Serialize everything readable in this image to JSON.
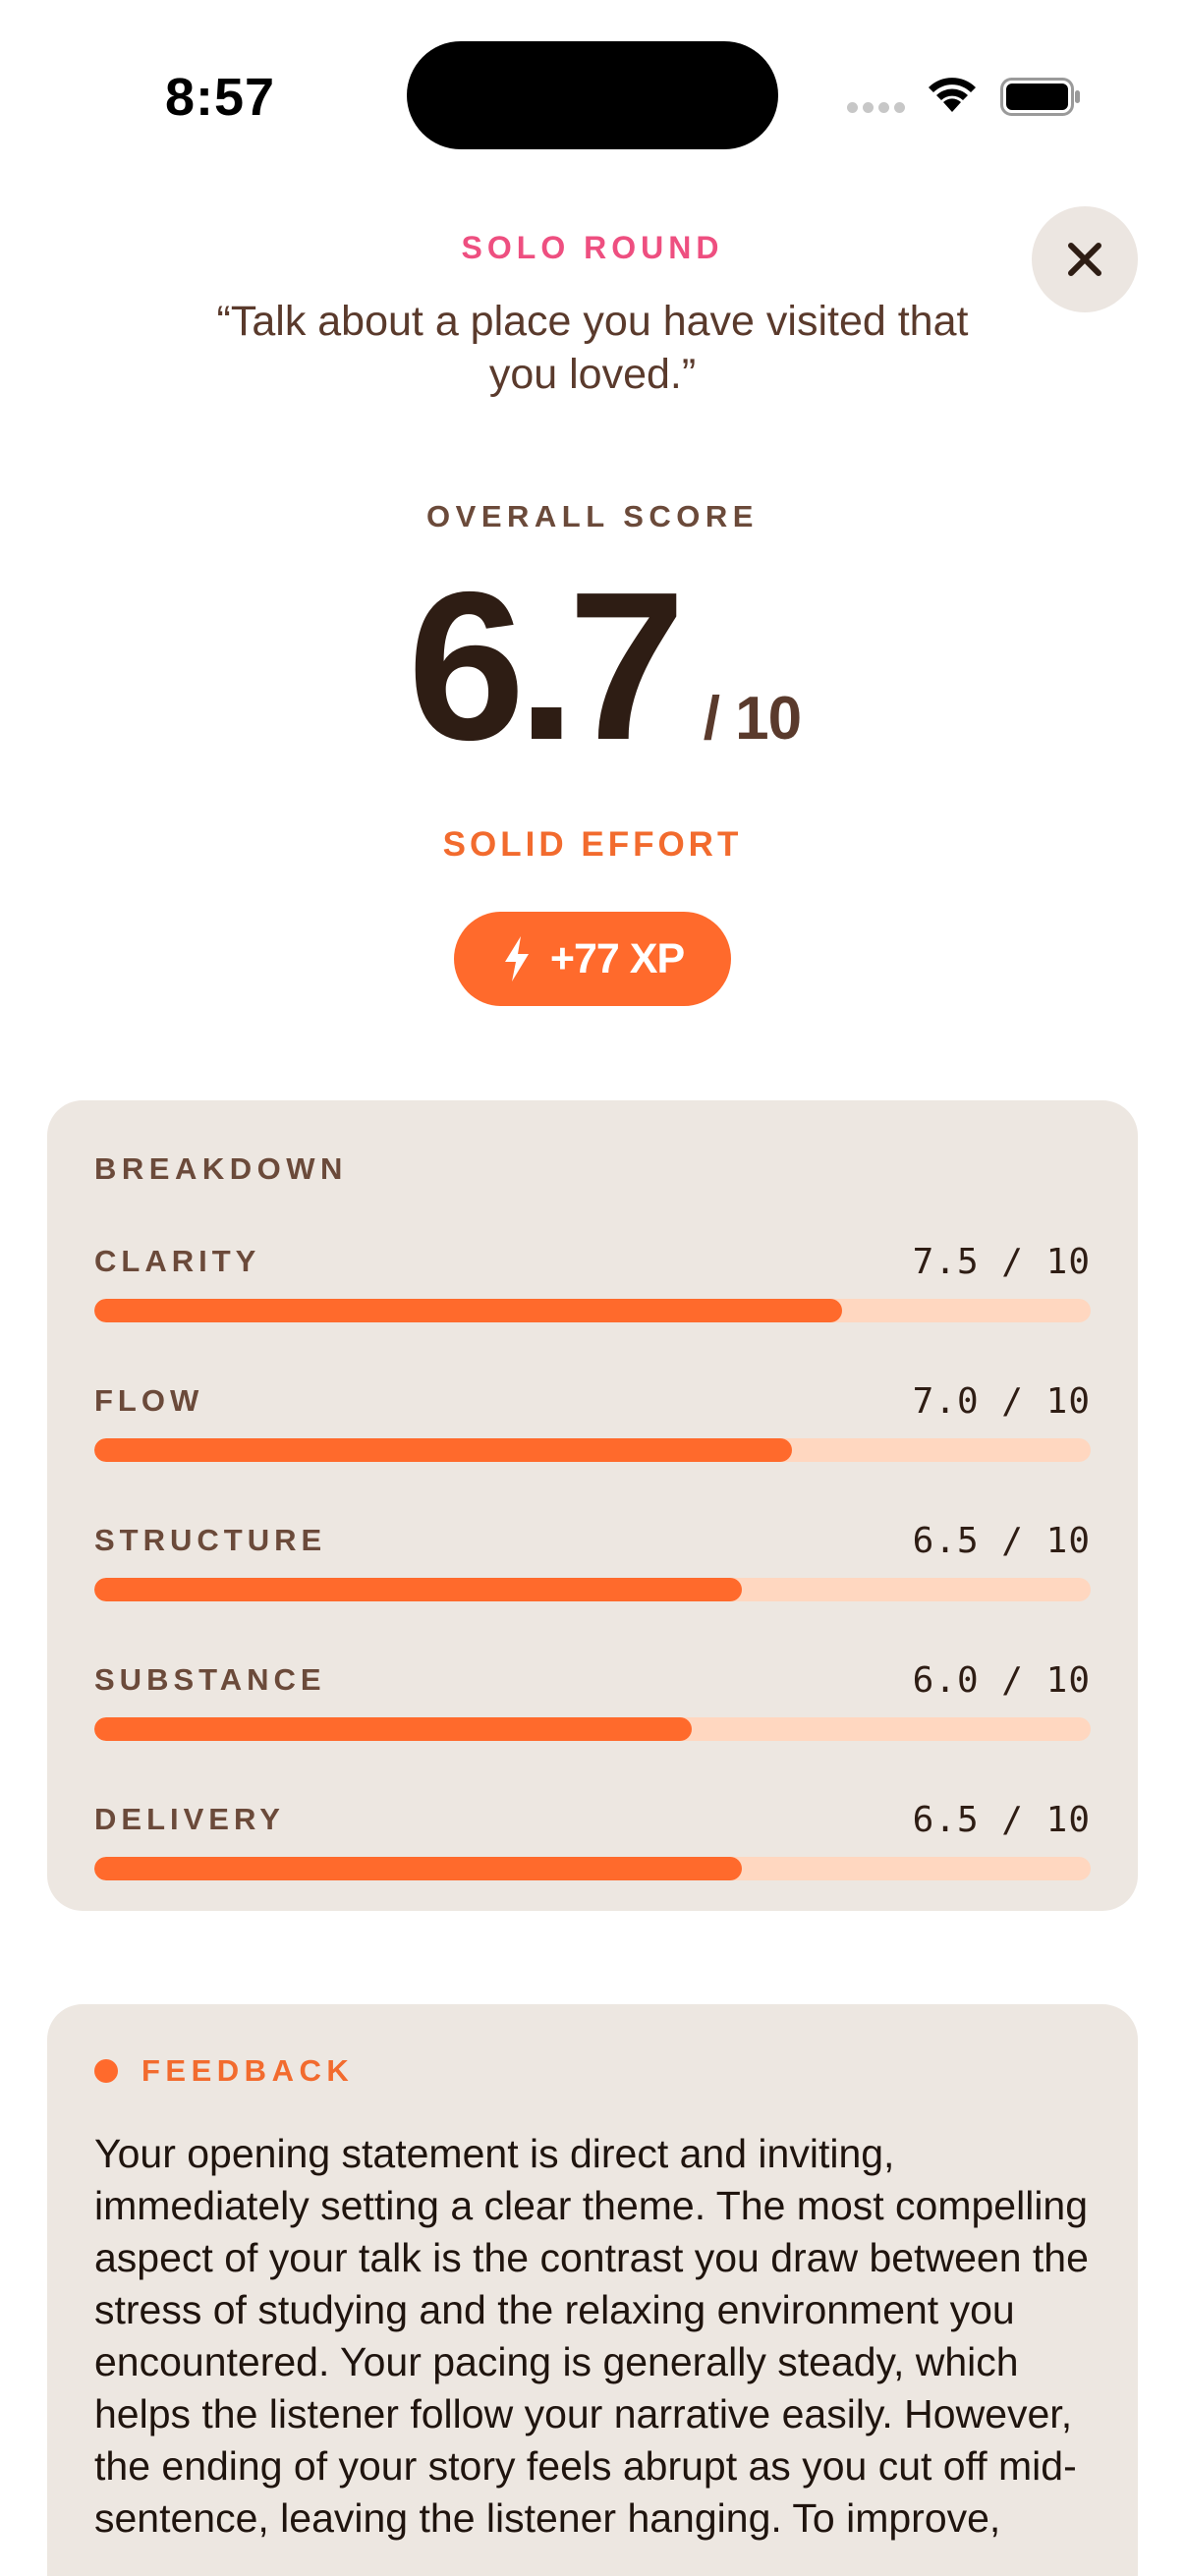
{
  "status_bar": {
    "time": "8:57"
  },
  "header": {
    "round_label": "SOLO ROUND",
    "prompt": "“Talk about a place you have visited that you loved.”",
    "close_icon": "close-icon"
  },
  "score": {
    "label": "OVERALL SCORE",
    "value": "6.7",
    "denominator": "/ 10",
    "verdict": "SOLID EFFORT",
    "xp": "+77 XP",
    "xp_icon": "lightning-icon"
  },
  "breakdown": {
    "title": "BREAKDOWN",
    "metrics": [
      {
        "name": "CLARITY",
        "score_text": "7.5 / 10",
        "value": 7.5
      },
      {
        "name": "FLOW",
        "score_text": "7.0 / 10",
        "value": 7.0
      },
      {
        "name": "STRUCTURE",
        "score_text": "6.5 / 10",
        "value": 6.5
      },
      {
        "name": "SUBSTANCE",
        "score_text": "6.0 / 10",
        "value": 6.0
      },
      {
        "name": "DELIVERY",
        "score_text": "6.5 / 10",
        "value": 6.5
      }
    ],
    "max": 10
  },
  "feedback": {
    "title": "FEEDBACK",
    "text": "Your opening statement is direct and inviting, immediately setting a clear theme. The most compelling aspect of your talk is the contrast you draw between the stress of studying and the relaxing environment you encountered. Your pacing is generally steady, which helps the listener follow your narrative easily. However, the ending of your story feels abrupt as you cut off mid-sentence, leaving the listener hanging. To improve,"
  },
  "colors": {
    "accent": "#ff6a2c",
    "pink": "#ee4f80",
    "card": "#ede7e1",
    "track": "#ffd7c0"
  }
}
